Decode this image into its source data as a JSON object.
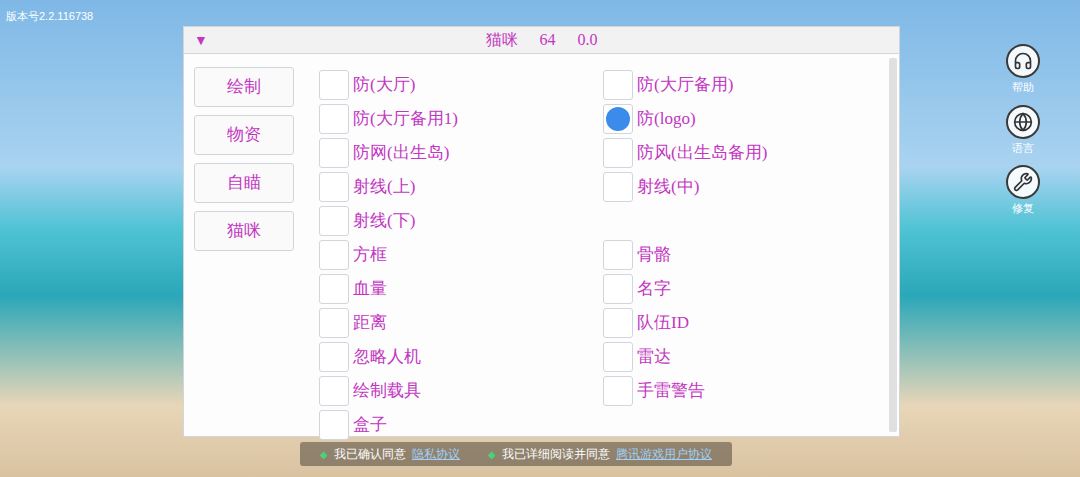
{
  "version": "版本号2.2.116738",
  "menu": {
    "toggle": "▼",
    "title": "猫咪",
    "level": "64",
    "value": "0.0",
    "tabs": [
      {
        "label": "绘制",
        "selected": false
      },
      {
        "label": "物资",
        "selected": false
      },
      {
        "label": "自瞄",
        "selected": false
      },
      {
        "label": "猫咪",
        "selected": false
      }
    ],
    "options": [
      [
        {
          "label": "防(大厅)",
          "kind": "checkbox",
          "checked": false
        },
        {
          "label": "防(大厅备用)",
          "kind": "checkbox",
          "checked": false
        }
      ],
      [
        {
          "label": "防(大厅备用1)",
          "kind": "checkbox",
          "checked": false
        },
        {
          "label": "防(logo)",
          "kind": "radio",
          "checked": true
        }
      ],
      [
        {
          "label": "防网(出生岛)",
          "kind": "checkbox",
          "checked": false
        },
        {
          "label": "防风(出生岛备用)",
          "kind": "checkbox",
          "checked": false
        }
      ],
      [
        {
          "label": "射线(上)",
          "kind": "checkbox",
          "checked": false
        },
        {
          "label": "射线(中)",
          "kind": "checkbox",
          "checked": false
        }
      ],
      [
        {
          "label": "射线(下)",
          "kind": "checkbox",
          "checked": false
        }
      ],
      [
        {
          "label": "方框",
          "kind": "checkbox",
          "checked": false
        },
        {
          "label": "骨骼",
          "kind": "checkbox",
          "checked": false
        }
      ],
      [
        {
          "label": "血量",
          "kind": "checkbox",
          "checked": false
        },
        {
          "label": "名字",
          "kind": "checkbox",
          "checked": false
        }
      ],
      [
        {
          "label": "距离",
          "kind": "checkbox",
          "checked": false
        },
        {
          "label": "队伍ID",
          "kind": "checkbox",
          "checked": false
        }
      ],
      [
        {
          "label": "忽略人机",
          "kind": "checkbox",
          "checked": false
        },
        {
          "label": "雷达",
          "kind": "checkbox",
          "checked": false
        }
      ],
      [
        {
          "label": "绘制载具",
          "kind": "checkbox",
          "checked": false
        },
        {
          "label": "手雷警告",
          "kind": "checkbox",
          "checked": false
        }
      ],
      [
        {
          "label": "盒子",
          "kind": "checkbox",
          "checked": false
        }
      ]
    ]
  },
  "side_buttons": [
    {
      "label": "帮助"
    },
    {
      "label": "语言"
    },
    {
      "label": "修复"
    }
  ],
  "agreements": [
    {
      "bullet": "◆",
      "text": "我已确认同意",
      "link": "隐私协议"
    },
    {
      "bullet": "◆",
      "text": "我已详细阅读并同意",
      "link": "腾讯游戏用户协议"
    }
  ]
}
